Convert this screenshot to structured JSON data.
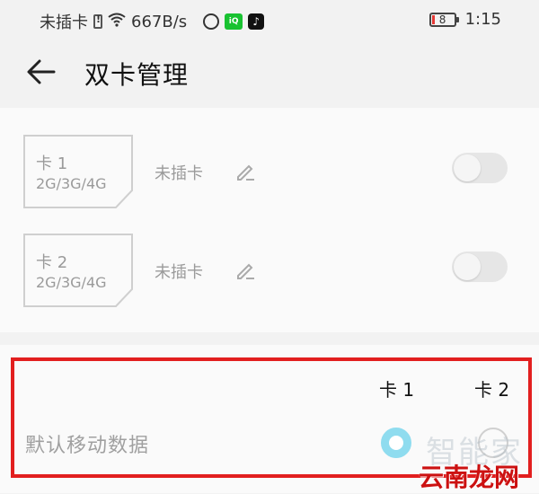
{
  "status_bar": {
    "carrier_text": "未插卡",
    "speed": "667B/s",
    "battery_level": "8",
    "time": "1:15",
    "icons": [
      "sim-absent-icon",
      "wifi-icon",
      "globe-app-icon",
      "iqiyi-app-icon",
      "tiktok-app-icon",
      "battery-icon"
    ]
  },
  "header": {
    "title": "双卡管理"
  },
  "sim_cards": [
    {
      "name": "卡 1",
      "network": "2G/3G/4G",
      "status": "未插卡",
      "enabled": false
    },
    {
      "name": "卡 2",
      "network": "2G/3G/4G",
      "status": "未插卡",
      "enabled": false
    }
  ],
  "default_data": {
    "col1": "卡 1",
    "col2": "卡 2",
    "label": "默认移动数据",
    "selected": "卡 1",
    "highlight_color": "#e21f1f"
  },
  "watermark": {
    "text": "智能家",
    "logo": "云南龙网"
  },
  "colors": {
    "accent_radio": "#8fdcef",
    "background": "#f2f2f2"
  }
}
